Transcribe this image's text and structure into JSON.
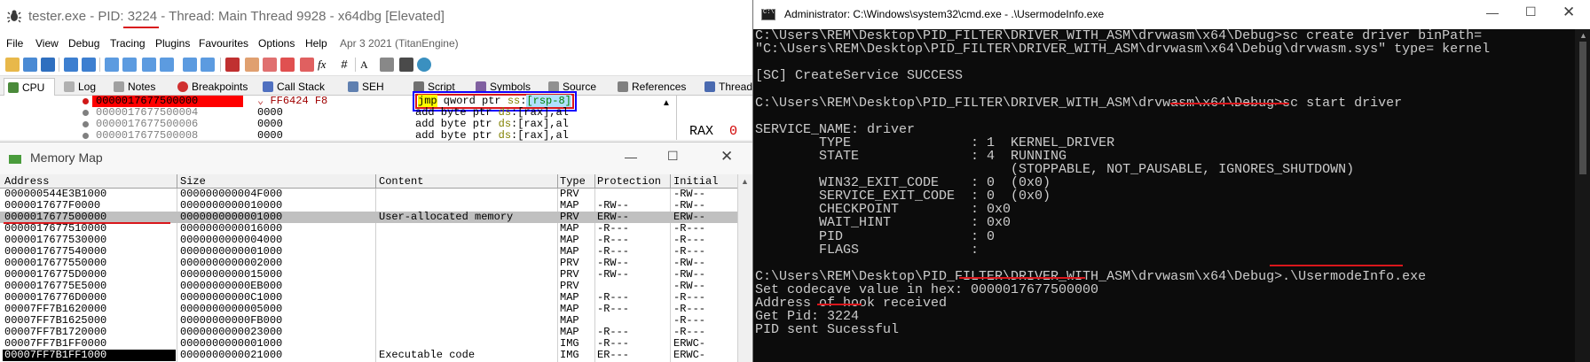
{
  "x64dbg": {
    "title_pre": "tester.exe - PID: ",
    "title_pid": "3224",
    "title_post": " - Thread: Main Thread 9928 - x64dbg [Elevated]",
    "menu": [
      "File",
      "View",
      "Debug",
      "Tracing",
      "Plugins",
      "Favourites",
      "Options",
      "Help",
      "Apr 3 2021 (TitanEngine)"
    ],
    "toolbar_icons": [
      "open-icon",
      "restart-icon",
      "stop-icon",
      "run-icon",
      "pause-icon",
      "step-into-icon",
      "step-over-icon",
      "trace-into-icon",
      "trace-over-icon",
      "run-to-user-icon",
      "execute-till-return-icon",
      "patch-icon",
      "comment-icon",
      "label-icon",
      "bookmark-icon",
      "function-icon",
      "hash-icon",
      "font-icon",
      "calculator-icon",
      "scripts-icon"
    ],
    "toolbar_glyphs": [
      "fx",
      "#",
      "A"
    ],
    "tabs": [
      "CPU",
      "Log",
      "Notes",
      "Breakpoints",
      "Call Stack",
      "SEH",
      "Script",
      "Symbols",
      "Source",
      "References",
      "Threads"
    ],
    "disasm": [
      {
        "address": "0000017677500000",
        "bytes": "FF6424 F8",
        "asm_jmp": "jmp",
        "asm_rest": " qword ptr ",
        "asm_seg": "ss",
        "asm_colon": ":",
        "asm_mem": "[rsp-8]"
      },
      {
        "address": "0000017677500004",
        "bytes": "0000",
        "asm_a": "add byte ptr ",
        "asm_seg": "ds",
        "asm_b": ":[rax],al"
      },
      {
        "address": "0000017677500006",
        "bytes": "0000",
        "asm_a": "add byte ptr ",
        "asm_seg": "ds",
        "asm_b": ":[rax],al"
      },
      {
        "address": "0000017677500008",
        "bytes": "0000",
        "asm_a": "add byte ptr ",
        "asm_seg": "ds",
        "asm_b": ":[rax],al"
      }
    ],
    "reg_label": "RAX",
    "reg_value_start": "0"
  },
  "memmap": {
    "title": "Memory Map",
    "headers": [
      "Address",
      "Size",
      "Content",
      "Type",
      "Protection",
      "Initial"
    ],
    "rows": [
      {
        "address": "000000544E3B1000",
        "size": "000000000004F000",
        "content": "",
        "type": "PRV",
        "protection": "",
        "initial": "-RW--"
      },
      {
        "address": "0000017677F0000",
        "size": "0000000000010000",
        "content": "",
        "type": "MAP",
        "protection": "-RW--",
        "initial": "-RW--"
      },
      {
        "address": "0000017677500000",
        "size": "0000000000001000",
        "content": "User-allocated memory",
        "type": "PRV",
        "protection": "ERW--",
        "initial": "ERW--"
      },
      {
        "address": "0000017677510000",
        "size": "0000000000016000",
        "content": "",
        "type": "MAP",
        "protection": "-R---",
        "initial": "-R---"
      },
      {
        "address": "0000017677530000",
        "size": "0000000000004000",
        "content": "",
        "type": "MAP",
        "protection": "-R---",
        "initial": "-R---"
      },
      {
        "address": "0000017677540000",
        "size": "0000000000001000",
        "content": "",
        "type": "MAP",
        "protection": "-R---",
        "initial": "-R---"
      },
      {
        "address": "0000017677550000",
        "size": "0000000000002000",
        "content": "",
        "type": "PRV",
        "protection": "-RW--",
        "initial": "-RW--"
      },
      {
        "address": "00000176775D0000",
        "size": "0000000000015000",
        "content": "",
        "type": "PRV",
        "protection": "-RW--",
        "initial": "-RW--"
      },
      {
        "address": "00000176775E5000",
        "size": "00000000000EB000",
        "content": "",
        "type": "PRV",
        "protection": "",
        "initial": "-RW--"
      },
      {
        "address": "00000176776D0000",
        "size": "00000000000C1000",
        "content": "",
        "type": "MAP",
        "protection": "-R---",
        "initial": "-R---"
      },
      {
        "address": "00007FF7B1620000",
        "size": "0000000000005000",
        "content": "",
        "type": "MAP",
        "protection": "-R---",
        "initial": "-R---"
      },
      {
        "address": "00007FF7B1625000",
        "size": "00000000000FB000",
        "content": "",
        "type": "MAP",
        "protection": "",
        "initial": "-R---"
      },
      {
        "address": "00007FF7B1720000",
        "size": "0000000000023000",
        "content": "",
        "type": "MAP",
        "protection": "-R---",
        "initial": "-R---"
      },
      {
        "address": "00007FF7B1FF0000",
        "size": "0000000000001000",
        "content": "",
        "type": "IMG",
        "protection": "-R---",
        "initial": "ERWC-"
      },
      {
        "address": "00007FF7B1FF1000",
        "size": "0000000000021000",
        "content": "Executable code",
        "type": "IMG",
        "protection": "ER---",
        "initial": "ERWC-"
      }
    ]
  },
  "cmd": {
    "title": "Administrator: C:\\Windows\\system32\\cmd.exe - .\\UsermodeInfo.exe",
    "lines": [
      "C:\\Users\\REM\\Desktop\\PID_FILTER\\DRIVER_WITH_ASM\\drvwasm\\x64\\Debug>sc create driver binPath=",
      "\"C:\\Users\\REM\\Desktop\\PID_FILTER\\DRIVER_WITH_ASM\\drvwasm\\x64\\Debug\\drvwasm.sys\" type= kernel",
      "",
      "[SC] CreateService SUCCESS",
      "",
      "C:\\Users\\REM\\Desktop\\PID_FILTER\\DRIVER_WITH_ASM\\drvwasm\\x64\\Debug>sc start driver",
      "",
      "SERVICE_NAME: driver",
      "        TYPE               : 1  KERNEL_DRIVER",
      "        STATE              : 4  RUNNING",
      "                                (STOPPABLE, NOT_PAUSABLE, IGNORES_SHUTDOWN)",
      "        WIN32_EXIT_CODE    : 0  (0x0)",
      "        SERVICE_EXIT_CODE  : 0  (0x0)",
      "        CHECKPOINT         : 0x0",
      "        WAIT_HINT          : 0x0",
      "        PID                : 0",
      "        FLAGS              :",
      "",
      "C:\\Users\\REM\\Desktop\\PID_FILTER\\DRIVER_WITH_ASM\\drvwasm\\x64\\Debug>.\\UsermodeInfo.exe",
      "Set codecave value in hex: 0000017677500000",
      "Address of hook received",
      "Get Pid: 3224",
      "PID sent Sucessful"
    ]
  },
  "colors": {
    "annotation_red": "#d9171c",
    "current_line_red": "#ff0000",
    "console_bg": "#0c0c0c",
    "console_fg": "#cccccc"
  }
}
